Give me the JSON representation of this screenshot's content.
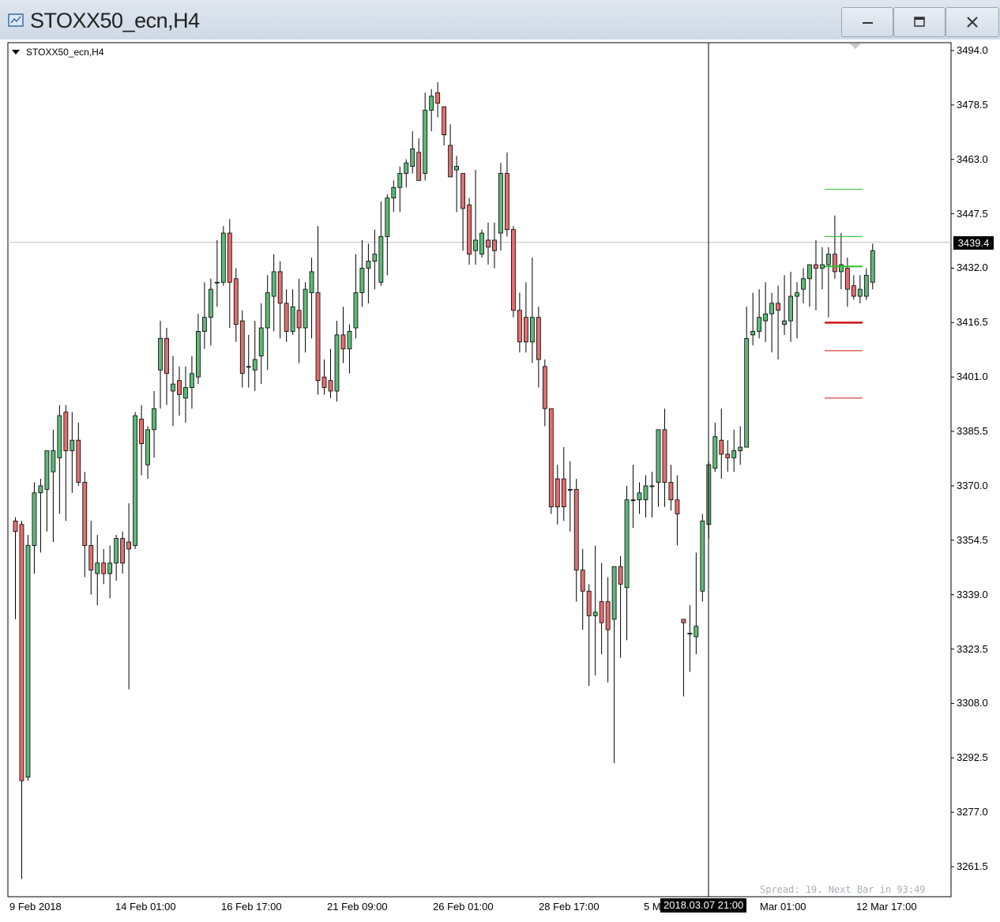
{
  "window": {
    "title": "STOXX50_ecn,H4",
    "controls": [
      "minimize",
      "restore",
      "close"
    ]
  },
  "chart": {
    "symbol_label": "STOXX50_ecn,H4",
    "current_price_label": "3439.4",
    "crosshair_time_label": "2018.03.07 21:00",
    "status_text": "Spread: 19. Next Bar in 93:49",
    "price_ticks": [
      "3494.0",
      "3478.5",
      "3463.0",
      "3447.5",
      "3432.0",
      "3416.5",
      "3401.0",
      "3385.5",
      "3370.0",
      "3354.5",
      "3339.0",
      "3323.5",
      "3308.0",
      "3292.5",
      "3277.0",
      "3261.5"
    ],
    "time_ticks": [
      "9 Feb 2018",
      "14 Feb 01:00",
      "16 Feb 17:00",
      "21 Feb 09:00",
      "26 Feb 01:00",
      "28 Feb 17:00",
      "5 M",
      "Mar 01:00",
      "12 Mar 17:00"
    ],
    "colors": {
      "bull": "#5fb87a",
      "bear": "#e06f6f",
      "wick": "#000000",
      "grid": "#c0c0c0",
      "green_level": "#2ec02e",
      "red_level": "#d01010"
    }
  },
  "chart_data": {
    "type": "candlestick",
    "ylim": [
      3257,
      3497
    ],
    "current_price": 3439.4,
    "crosshair_time": "2018.03.07 21:00",
    "green_levels": [
      3454.5,
      3441,
      3432.5
    ],
    "red_levels": [
      3416.5,
      3408.5,
      3395
    ],
    "candles": [
      [
        3360,
        3361,
        3332,
        3357
      ],
      [
        3359,
        3360,
        3258,
        3286
      ],
      [
        3287,
        3356,
        3286,
        3353
      ],
      [
        3353,
        3371,
        3345,
        3368
      ],
      [
        3368,
        3372,
        3351,
        3370
      ],
      [
        3369,
        3380,
        3357,
        3380
      ],
      [
        3374,
        3386,
        3354,
        3380
      ],
      [
        3378,
        3393,
        3362,
        3390
      ],
      [
        3391,
        3393,
        3360,
        3380
      ],
      [
        3380,
        3391,
        3368,
        3383
      ],
      [
        3383,
        3388,
        3370,
        3371
      ],
      [
        3371,
        3374,
        3344,
        3353
      ],
      [
        3353,
        3360,
        3339,
        3346
      ],
      [
        3345,
        3356,
        3336,
        3348
      ],
      [
        3348,
        3352,
        3342,
        3345
      ],
      [
        3345,
        3353,
        3338,
        3348
      ],
      [
        3348,
        3356,
        3343,
        3355
      ],
      [
        3355,
        3357,
        3345,
        3348
      ],
      [
        3354,
        3365,
        3312,
        3352
      ],
      [
        3353,
        3391,
        3352,
        3390
      ],
      [
        3389,
        3393,
        3373,
        3382
      ],
      [
        3376,
        3387,
        3372,
        3386
      ],
      [
        3386,
        3397,
        3378,
        3392
      ],
      [
        3403,
        3417,
        3392,
        3412
      ],
      [
        3412,
        3415,
        3393,
        3402
      ],
      [
        3397,
        3407,
        3387,
        3399
      ],
      [
        3400,
        3404,
        3390,
        3396
      ],
      [
        3395,
        3404,
        3388,
        3398
      ],
      [
        3398,
        3407,
        3392,
        3402
      ],
      [
        3401,
        3419,
        3399,
        3414
      ],
      [
        3414,
        3428,
        3409,
        3418
      ],
      [
        3418,
        3429,
        3410,
        3426
      ],
      [
        3428,
        3440,
        3421,
        3428
      ],
      [
        3428,
        3444,
        3427,
        3442
      ],
      [
        3442,
        3446,
        3415,
        3428
      ],
      [
        3429,
        3432,
        3411,
        3416
      ],
      [
        3417,
        3420,
        3398,
        3402
      ],
      [
        3404,
        3413,
        3398,
        3404
      ],
      [
        3403,
        3417,
        3397,
        3406
      ],
      [
        3407,
        3422,
        3399,
        3415
      ],
      [
        3415,
        3430,
        3403,
        3425
      ],
      [
        3424,
        3436,
        3414,
        3431
      ],
      [
        3431,
        3434,
        3412,
        3422
      ],
      [
        3422,
        3426,
        3411,
        3414
      ],
      [
        3414,
        3426,
        3413,
        3421
      ],
      [
        3420,
        3429,
        3405,
        3415
      ],
      [
        3415,
        3428,
        3408,
        3426
      ],
      [
        3425,
        3435,
        3412,
        3431
      ],
      [
        3425,
        3444,
        3396,
        3400
      ],
      [
        3401,
        3406,
        3396,
        3398
      ],
      [
        3400,
        3409,
        3395,
        3397
      ],
      [
        3397,
        3417,
        3394,
        3413
      ],
      [
        3413,
        3421,
        3405,
        3409
      ],
      [
        3409,
        3416,
        3402,
        3414
      ],
      [
        3415,
        3436,
        3412,
        3425
      ],
      [
        3425,
        3440,
        3421,
        3432
      ],
      [
        3432,
        3439,
        3422,
        3434
      ],
      [
        3434,
        3443,
        3426,
        3436
      ],
      [
        3428,
        3451,
        3427,
        3441
      ],
      [
        3441,
        3453,
        3430,
        3452
      ],
      [
        3452,
        3457,
        3448,
        3455
      ],
      [
        3455,
        3461,
        3448,
        3459
      ],
      [
        3459,
        3463,
        3455,
        3462
      ],
      [
        3461,
        3471,
        3459,
        3466
      ],
      [
        3465,
        3469,
        3457,
        3457
      ],
      [
        3459,
        3482,
        3457,
        3477
      ],
      [
        3477,
        3483,
        3471,
        3481
      ],
      [
        3482,
        3485,
        3475,
        3479
      ],
      [
        3478,
        3478,
        3467,
        3470
      ],
      [
        3467,
        3473,
        3458,
        3458
      ],
      [
        3460,
        3464,
        3448,
        3461
      ],
      [
        3459,
        3459,
        3437,
        3449
      ],
      [
        3450,
        3452,
        3433,
        3436
      ],
      [
        3437,
        3460,
        3433,
        3440
      ],
      [
        3436,
        3443,
        3435,
        3442
      ],
      [
        3440,
        3445,
        3433,
        3438
      ],
      [
        3440,
        3445,
        3432,
        3437
      ],
      [
        3442,
        3462,
        3437,
        3459
      ],
      [
        3459,
        3465,
        3441,
        3443
      ],
      [
        3443,
        3444,
        3418,
        3420
      ],
      [
        3420,
        3425,
        3408,
        3411
      ],
      [
        3418,
        3428,
        3408,
        3411
      ],
      [
        3411,
        3435,
        3405,
        3418
      ],
      [
        3418,
        3421,
        3398,
        3406
      ],
      [
        3404,
        3406,
        3387,
        3392
      ],
      [
        3392,
        3390,
        3362,
        3364
      ],
      [
        3372,
        3376,
        3359,
        3364
      ],
      [
        3372,
        3381,
        3360,
        3364
      ],
      [
        3369,
        3377,
        3357,
        3369
      ],
      [
        3369,
        3372,
        3337,
        3346
      ],
      [
        3346,
        3352,
        3329,
        3340
      ],
      [
        3340,
        3342,
        3313,
        3333
      ],
      [
        3333,
        3353,
        3316,
        3334
      ],
      [
        3337,
        3348,
        3322,
        3331
      ],
      [
        3337,
        3344,
        3314,
        3329
      ],
      [
        3332,
        3347,
        3291,
        3347
      ],
      [
        3347,
        3350,
        3321,
        3342
      ],
      [
        3341,
        3370,
        3326,
        3366
      ],
      [
        3366,
        3376,
        3358,
        3366
      ],
      [
        3366,
        3371,
        3362,
        3368
      ],
      [
        3366,
        3373,
        3361,
        3370
      ],
      [
        3370,
        3374,
        3361,
        3370
      ],
      [
        3371,
        3384,
        3364,
        3386
      ],
      [
        3386,
        3392,
        3364,
        3371
      ],
      [
        3371,
        3376,
        3363,
        3366
      ],
      [
        3366,
        3373,
        3353,
        3362
      ],
      [
        3332,
        3332,
        3310,
        3331
      ],
      [
        3328,
        3336,
        3317,
        3328
      ],
      [
        3327,
        3351,
        3322,
        3330
      ],
      [
        3340,
        3362,
        3337,
        3360
      ],
      [
        3359,
        3377,
        3355,
        3376
      ],
      [
        3375,
        3388,
        3374,
        3384
      ],
      [
        3383,
        3392,
        3372,
        3379
      ],
      [
        3379,
        3383,
        3374,
        3378
      ],
      [
        3378,
        3386,
        3374,
        3380
      ],
      [
        3380,
        3387,
        3376,
        3381
      ],
      [
        3381,
        3421,
        3381,
        3412
      ],
      [
        3413,
        3425,
        3410,
        3414
      ],
      [
        3414,
        3426,
        3412,
        3418
      ],
      [
        3417,
        3428,
        3411,
        3419
      ],
      [
        3419,
        3425,
        3408,
        3422
      ],
      [
        3422,
        3427,
        3406,
        3420
      ],
      [
        3416,
        3430,
        3413,
        3417
      ],
      [
        3417,
        3431,
        3411,
        3424
      ],
      [
        3424,
        3428,
        3412,
        3425
      ],
      [
        3426,
        3432,
        3422,
        3429
      ],
      [
        3429,
        3432,
        3421,
        3433
      ],
      [
        3433,
        3440,
        3420,
        3432
      ],
      [
        3432,
        3438,
        3426,
        3433
      ],
      [
        3433,
        3438,
        3418,
        3436
      ],
      [
        3436,
        3447,
        3429,
        3431
      ],
      [
        3431,
        3442,
        3426,
        3433
      ],
      [
        3432,
        3435,
        3421,
        3426
      ],
      [
        3427,
        3430,
        3423,
        3424
      ],
      [
        3424,
        3430,
        3422,
        3426
      ],
      [
        3424,
        3432,
        3423,
        3430
      ],
      [
        3428,
        3439,
        3426,
        3437
      ]
    ]
  }
}
